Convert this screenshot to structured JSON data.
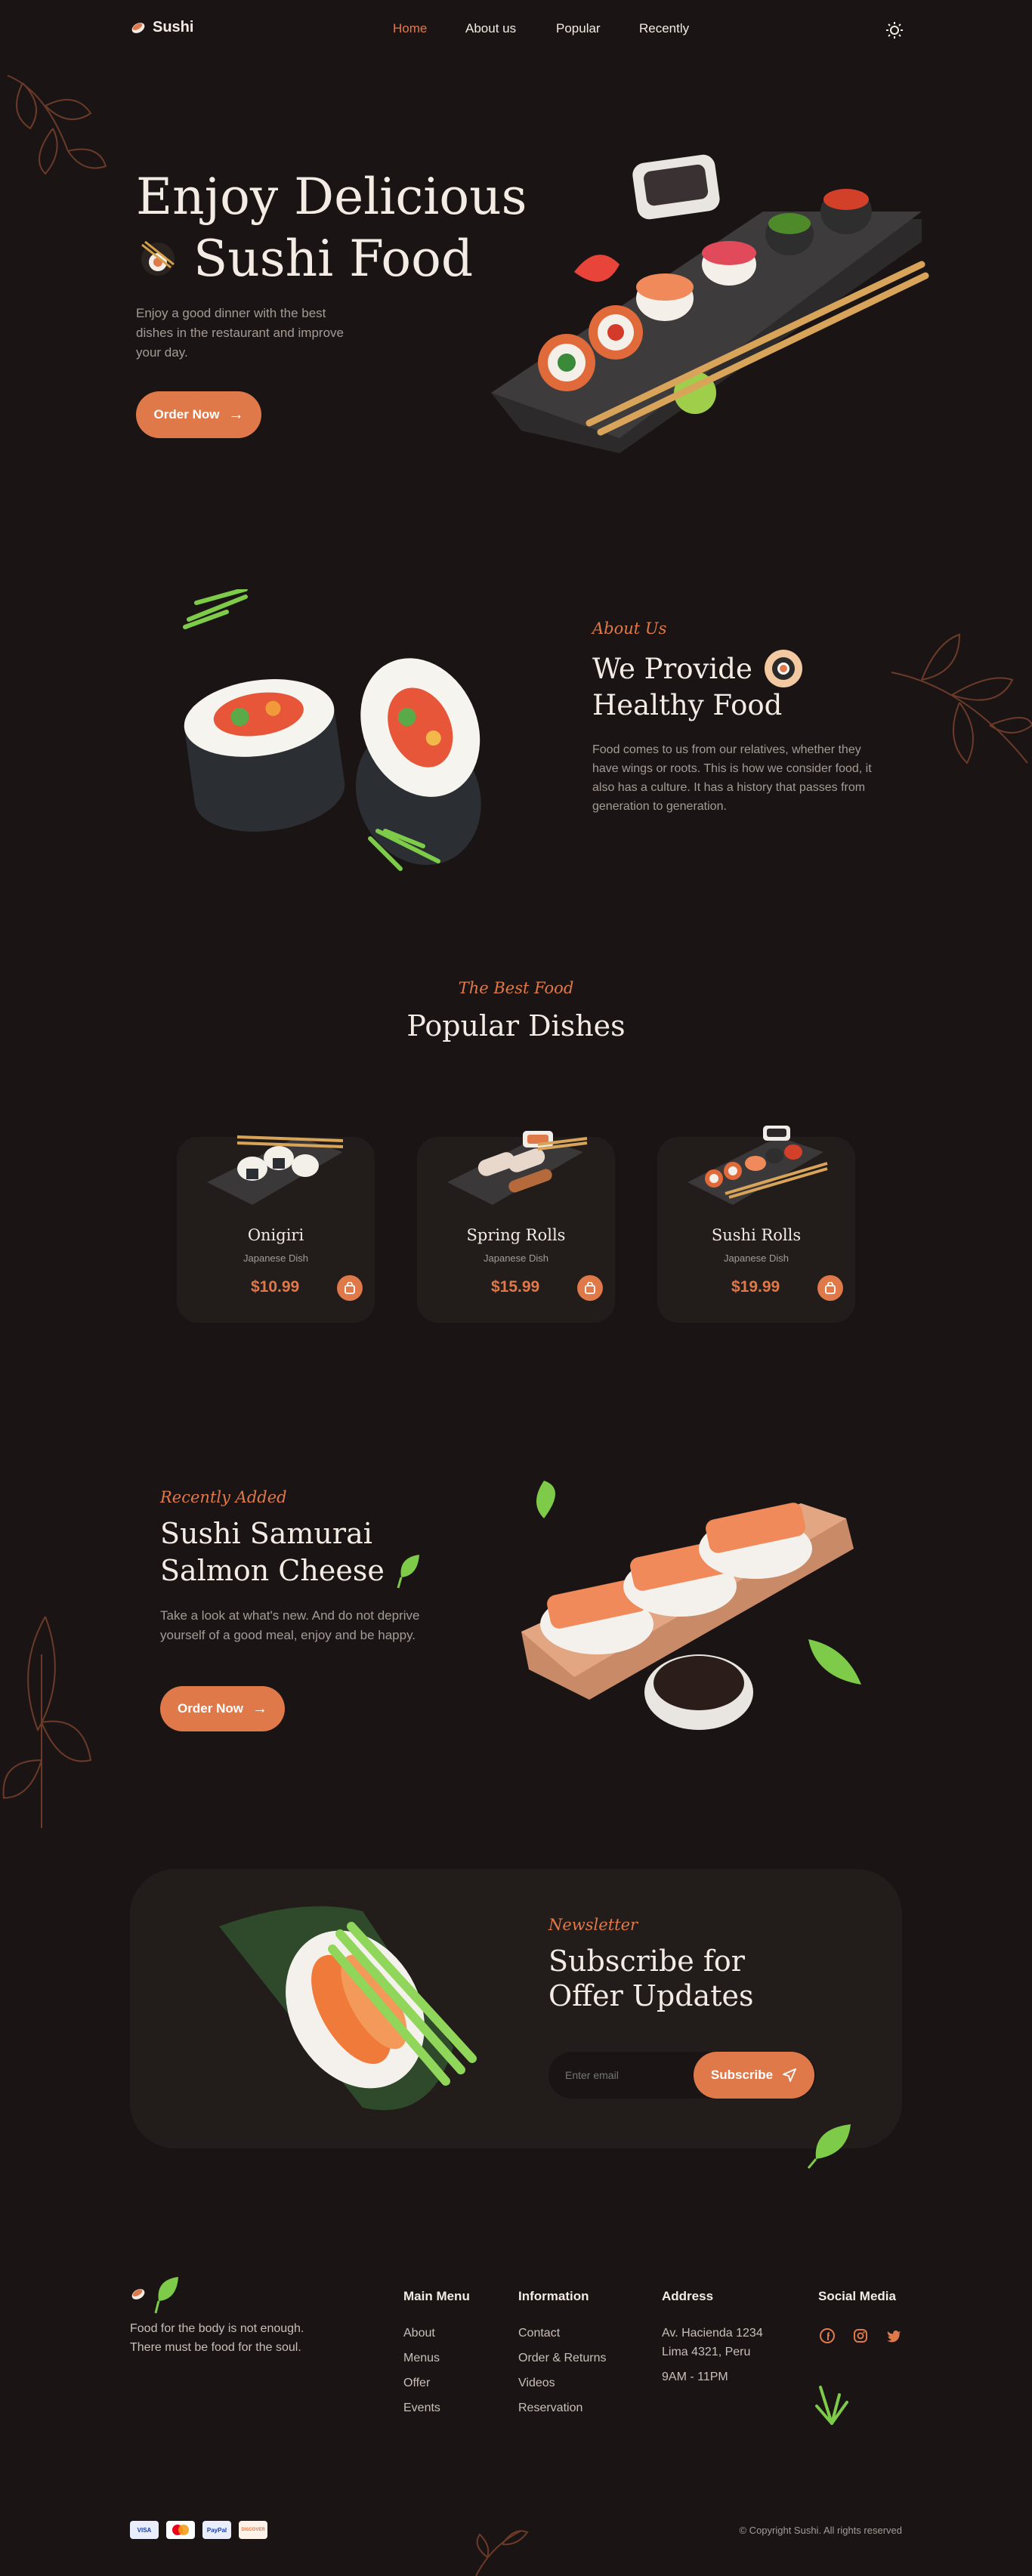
{
  "brand": {
    "name": "Sushi"
  },
  "nav": {
    "items": [
      "Home",
      "About us",
      "Popular",
      "Recently"
    ],
    "active": "Home"
  },
  "hero": {
    "title_line1": "Enjoy Delicious",
    "title_line2": "Sushi Food",
    "desc": "Enjoy a good dinner with the best dishes in the restaurant and improve your day.",
    "cta": "Order Now"
  },
  "about": {
    "kicker": "About Us",
    "title_line1": "We Provide",
    "title_line2": "Healthy Food",
    "desc": "Food comes to us from our relatives, whether they have wings or roots. This is how we consider food, it also has a culture. It has a history that passes from generation to generation."
  },
  "popular": {
    "kicker": "The Best Food",
    "title": "Popular Dishes",
    "dishes": [
      {
        "name": "Onigiri",
        "sub": "Japanese Dish",
        "price": "$10.99"
      },
      {
        "name": "Spring Rolls",
        "sub": "Japanese Dish",
        "price": "$15.99"
      },
      {
        "name": "Sushi Rolls",
        "sub": "Japanese Dish",
        "price": "$19.99"
      }
    ]
  },
  "recent": {
    "kicker": "Recently Added",
    "title_line1": "Sushi Samurai",
    "title_line2": "Salmon Cheese",
    "desc": "Take a look at what's new. And do not deprive yourself of a good meal, enjoy and be happy.",
    "cta": "Order Now"
  },
  "newsletter": {
    "kicker": "Newsletter",
    "title_line1": "Subscribe for",
    "title_line2": "Offer Updates",
    "placeholder": "Enter email",
    "button": "Subscribe"
  },
  "footer": {
    "tagline": "Food for the body is not enough. There must be food for the soul.",
    "main_menu": {
      "title": "Main Menu",
      "items": [
        "About",
        "Menus",
        "Offer",
        "Events"
      ]
    },
    "information": {
      "title": "Information",
      "items": [
        "Contact",
        "Order & Returns",
        "Videos",
        "Reservation"
      ]
    },
    "address": {
      "title": "Address",
      "line1": "Av. Hacienda 1234",
      "line2": "Lima 4321, Peru",
      "hours": "9AM - 11PM"
    },
    "social": {
      "title": "Social Media",
      "icons": [
        "facebook-icon",
        "instagram-icon",
        "twitter-icon"
      ]
    },
    "payments": [
      "VISA",
      "mastercard",
      "PayPal",
      "DISCOVER"
    ],
    "copyright": "© Copyright Sushi. All rights reserved"
  },
  "colors": {
    "background": "#1a1514",
    "accent": "#e0794a",
    "card": "#221c1b",
    "text": "#f3ebe4",
    "muted": "#a49b95"
  }
}
